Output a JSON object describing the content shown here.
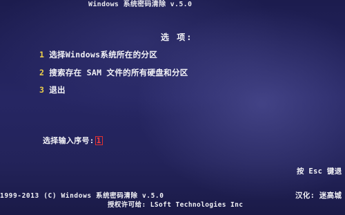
{
  "header": {
    "title": "Windows 系统密码清除 v.5.0"
  },
  "menu": {
    "heading": "选 项:",
    "items": [
      {
        "number": "1",
        "label": "选择Windows系统所在的分区"
      },
      {
        "number": "2",
        "label": "搜索存在 SAM 文件的所有硬盘和分区"
      },
      {
        "number": "3",
        "label": "退出"
      }
    ]
  },
  "prompt": {
    "label": "选择输入序号:",
    "value": "1"
  },
  "hints": {
    "esc": "按 Esc 键退"
  },
  "footer": {
    "copyright": "1999-2013 (C) Windows 系统密码清除 v.5.0",
    "author": "授权许可给: LSoft Technologies Inc",
    "localized": "汉化: 迷高城"
  },
  "colors": {
    "background": "#23235a",
    "text": "#f2f2f6",
    "number_accent": "#f0d24a",
    "input_border": "#e23030"
  }
}
